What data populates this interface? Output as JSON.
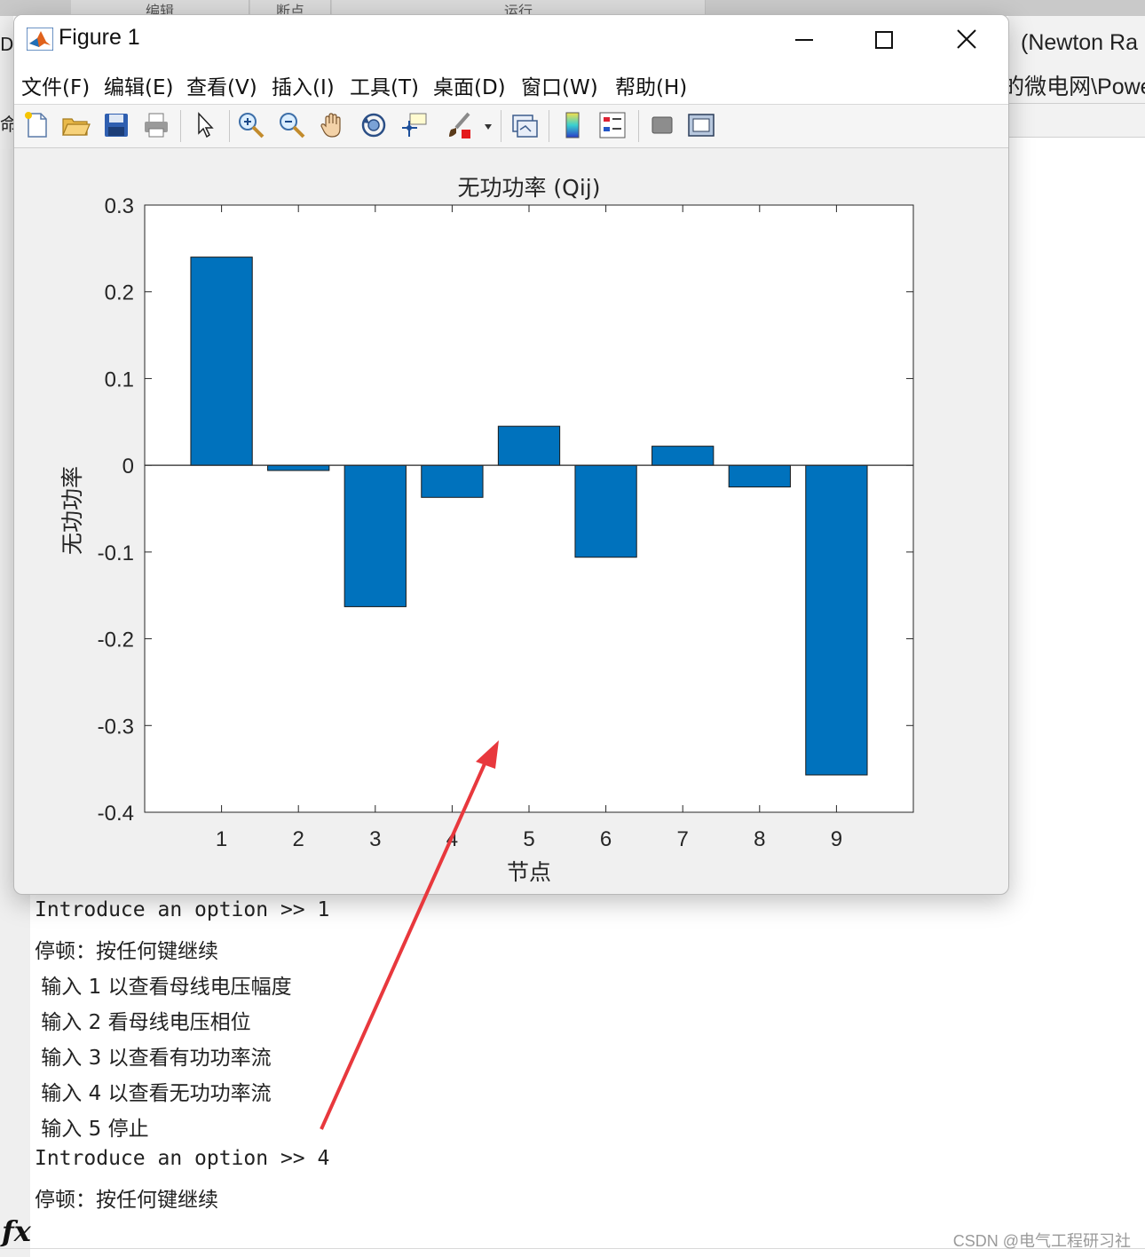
{
  "background": {
    "top_tabs": [
      "编辑",
      "断点",
      "运行"
    ],
    "right_panel_title": "(Newton Ra",
    "right_panel_path": "的微电网\\Powe",
    "left_cut_text_1": "Do",
    "left_cut_text_2": "命"
  },
  "figure": {
    "title": "Figure 1",
    "menu": [
      "文件(F)",
      "编辑(E)",
      "查看(V)",
      "插入(I)",
      "工具(T)",
      "桌面(D)",
      "窗口(W)",
      "帮助(H)"
    ],
    "toolbar_icons": [
      "new-file-icon",
      "open-folder-icon",
      "save-icon",
      "print-icon",
      "pointer-icon",
      "zoom-in-icon",
      "zoom-out-icon",
      "pan-hand-icon",
      "rotate-3d-icon",
      "data-cursor-icon",
      "brush-icon",
      "link-plot-icon",
      "colorbar-icon",
      "legend-icon",
      "hide-plot-tools-icon",
      "show-plot-tools-icon"
    ]
  },
  "chart_data": {
    "type": "bar",
    "title": "无功功率 (Qij)",
    "xlabel": "节点",
    "ylabel": "无功功率",
    "categories": [
      "1",
      "2",
      "3",
      "4",
      "5",
      "6",
      "7",
      "8",
      "9"
    ],
    "values": [
      0.24,
      -0.006,
      -0.163,
      -0.037,
      0.045,
      -0.106,
      0.022,
      -0.025,
      -0.357
    ],
    "ylim": [
      -0.4,
      0.3
    ],
    "xlim": [
      0,
      10
    ],
    "yticks": [
      "-0.4",
      "-0.3",
      "-0.2",
      "-0.1",
      "0",
      "0.1",
      "0.2",
      "0.3"
    ],
    "ytick_values": [
      -0.4,
      -0.3,
      -0.2,
      -0.1,
      0,
      0.1,
      0.2,
      0.3
    ],
    "bar_color": "#0072BD",
    "grid": false
  },
  "console": {
    "lines": [
      "Introduce an option >> 1",
      "停顿：按任何键继续",
      " 输入 1 以查看母线电压幅度",
      " 输入 2 看母线电压相位",
      " 输入 3 以查看有功功率流",
      " 输入 4 以查看无功功率流",
      " 输入 5 停止",
      "Introduce an option >> 4",
      "停顿：按任何键继续"
    ]
  },
  "fx_label": "fx",
  "watermark": "CSDN @电气工程研习社",
  "annotation_color": "#e8383d"
}
